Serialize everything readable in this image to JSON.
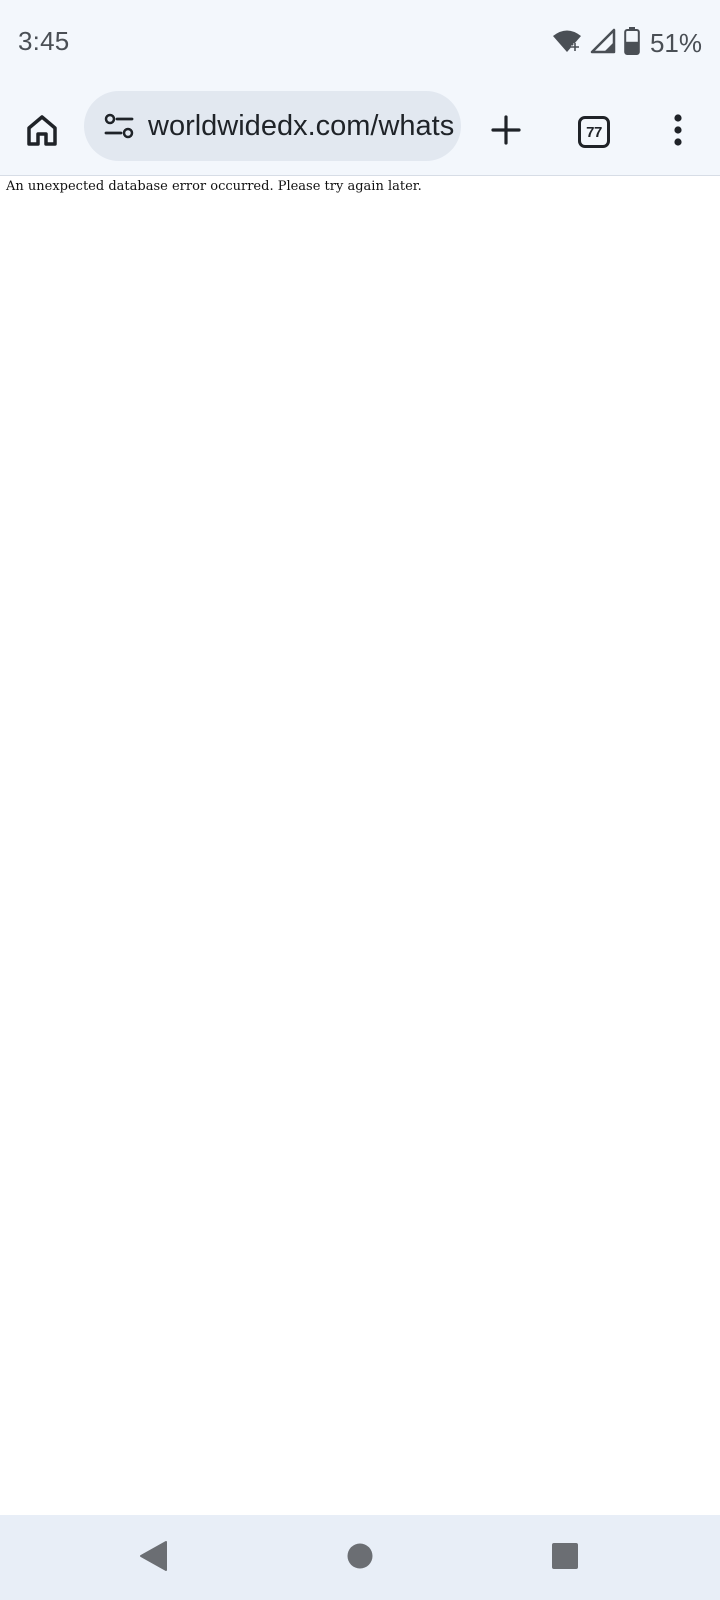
{
  "status_bar": {
    "time": "3:45",
    "battery_percent": "51%",
    "icons": [
      "wifi-icon",
      "cell-signal-icon",
      "battery-icon"
    ],
    "battery_level": 0.51
  },
  "toolbar": {
    "url": "worldwidedx.com/whats",
    "tab_count": "77",
    "icons": [
      "home-icon",
      "tune-icon",
      "plus-icon",
      "tab-switcher-icon",
      "more-vert-icon"
    ]
  },
  "page": {
    "error_message": "An unexpected database error occurred. Please try again later."
  },
  "nav_bar": {
    "icons": [
      "back-icon",
      "home-circle-icon",
      "recents-icon"
    ]
  },
  "colors": {
    "chrome_background": "#f3f7fc",
    "omnibox_background": "#e2e8f0",
    "nav_background": "#e8eef7",
    "icon_dark": "#1f2328",
    "status_text": "#4a4f55"
  }
}
